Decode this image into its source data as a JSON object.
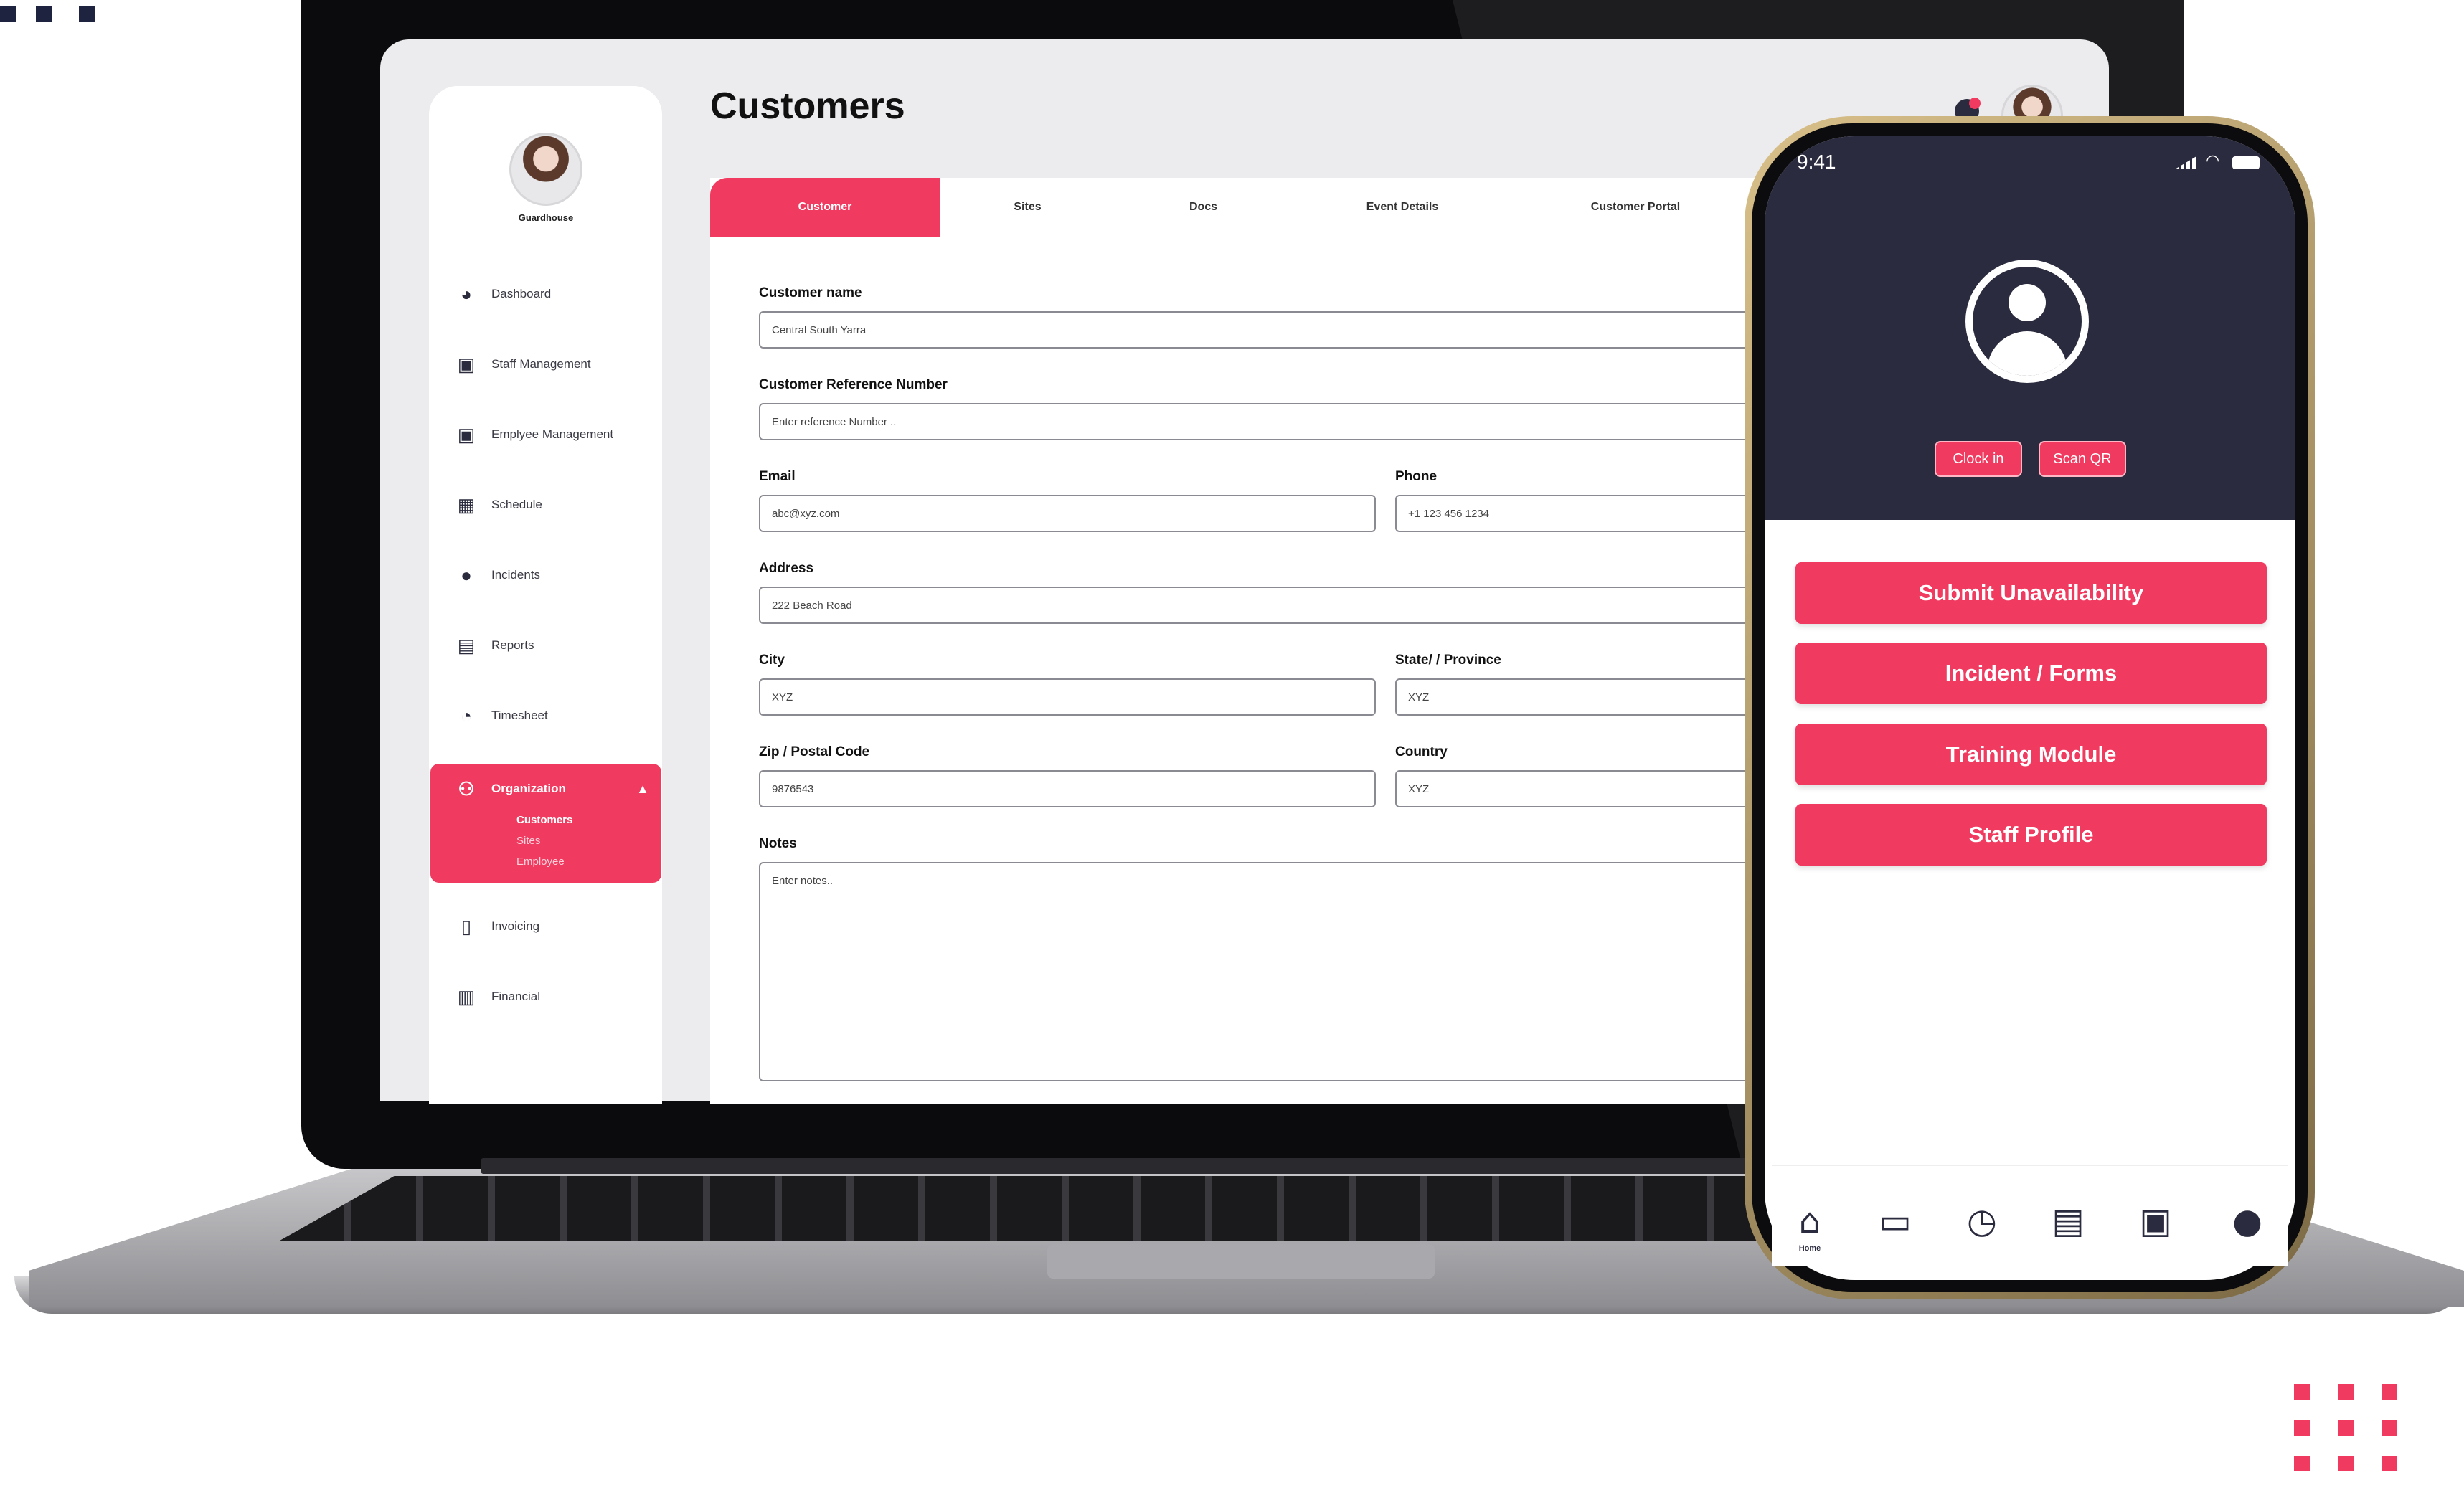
{
  "colors": {
    "accent": "#f03a5f",
    "navy": "#2a2b3e",
    "screen_bg": "#ececee"
  },
  "desktop": {
    "page_title": "Customers",
    "profile": {
      "name": "Guardhouse"
    },
    "sidebar": {
      "items": [
        {
          "label": "Dashboard",
          "icon": "dashboard-icon"
        },
        {
          "label": "Staff Management",
          "icon": "staff-icon"
        },
        {
          "label": "Emplyee Management",
          "icon": "employee-icon"
        },
        {
          "label": "Schedule",
          "icon": "calendar-icon"
        },
        {
          "label": "Incidents",
          "icon": "incident-icon"
        },
        {
          "label": "Reports",
          "icon": "table-icon"
        },
        {
          "label": "Timesheet",
          "icon": "clock-icon"
        },
        {
          "label": "Organization",
          "icon": "people-icon",
          "expanded": true,
          "children": [
            "Customers",
            "Sites",
            "Employee"
          ]
        },
        {
          "label": "Invoicing",
          "icon": "invoice-icon"
        },
        {
          "label": "Financial",
          "icon": "calculator-icon"
        }
      ]
    },
    "tabs": [
      "Customer",
      "Sites",
      "Docs",
      "Event Details",
      "Customer Portal"
    ],
    "active_tab": "Customer",
    "form": {
      "customer_name": {
        "label": "Customer name",
        "value": "Central South Yarra"
      },
      "reference": {
        "label": "Customer Reference Number",
        "placeholder": "Enter reference Number .."
      },
      "email": {
        "label": "Email",
        "value": "abc@xyz.com"
      },
      "phone": {
        "label": "Phone",
        "value": "+1 123 456 1234"
      },
      "address": {
        "label": "Address",
        "value": "222 Beach Road"
      },
      "city": {
        "label": "City",
        "value": "XYZ"
      },
      "state": {
        "label": "State/ / Province",
        "value": "XYZ"
      },
      "zip": {
        "label": "Zip / Postal Code",
        "value": "9876543"
      },
      "country": {
        "label": "Country",
        "value": "XYZ"
      },
      "notes": {
        "label": "Notes",
        "placeholder": "Enter notes.."
      }
    }
  },
  "mobile": {
    "status_time": "9:41",
    "buttons": {
      "clock_in": "Clock in",
      "scan_qr": "Scan QR"
    },
    "actions": [
      "Submit Unavailability",
      "Incident / Forms",
      "Training Module",
      "Staff Profile"
    ],
    "tabbar": {
      "home_label": "Home",
      "icons": [
        "home-icon",
        "calendar-icon",
        "alarm-icon",
        "notes-icon",
        "id-card-icon",
        "user-icon"
      ]
    }
  }
}
